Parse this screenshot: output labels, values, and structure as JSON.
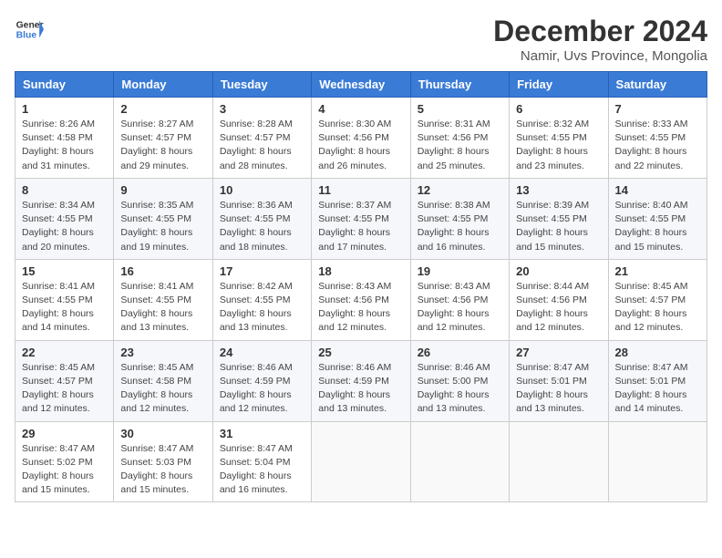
{
  "logo": {
    "general": "General",
    "blue": "Blue"
  },
  "title": "December 2024",
  "subtitle": "Namir, Uvs Province, Mongolia",
  "days_of_week": [
    "Sunday",
    "Monday",
    "Tuesday",
    "Wednesday",
    "Thursday",
    "Friday",
    "Saturday"
  ],
  "weeks": [
    [
      {
        "day": 1,
        "sunrise": "8:26 AM",
        "sunset": "4:58 PM",
        "daylight": "8 hours and 31 minutes."
      },
      {
        "day": 2,
        "sunrise": "8:27 AM",
        "sunset": "4:57 PM",
        "daylight": "8 hours and 29 minutes."
      },
      {
        "day": 3,
        "sunrise": "8:28 AM",
        "sunset": "4:57 PM",
        "daylight": "8 hours and 28 minutes."
      },
      {
        "day": 4,
        "sunrise": "8:30 AM",
        "sunset": "4:56 PM",
        "daylight": "8 hours and 26 minutes."
      },
      {
        "day": 5,
        "sunrise": "8:31 AM",
        "sunset": "4:56 PM",
        "daylight": "8 hours and 25 minutes."
      },
      {
        "day": 6,
        "sunrise": "8:32 AM",
        "sunset": "4:55 PM",
        "daylight": "8 hours and 23 minutes."
      },
      {
        "day": 7,
        "sunrise": "8:33 AM",
        "sunset": "4:55 PM",
        "daylight": "8 hours and 22 minutes."
      }
    ],
    [
      {
        "day": 8,
        "sunrise": "8:34 AM",
        "sunset": "4:55 PM",
        "daylight": "8 hours and 20 minutes."
      },
      {
        "day": 9,
        "sunrise": "8:35 AM",
        "sunset": "4:55 PM",
        "daylight": "8 hours and 19 minutes."
      },
      {
        "day": 10,
        "sunrise": "8:36 AM",
        "sunset": "4:55 PM",
        "daylight": "8 hours and 18 minutes."
      },
      {
        "day": 11,
        "sunrise": "8:37 AM",
        "sunset": "4:55 PM",
        "daylight": "8 hours and 17 minutes."
      },
      {
        "day": 12,
        "sunrise": "8:38 AM",
        "sunset": "4:55 PM",
        "daylight": "8 hours and 16 minutes."
      },
      {
        "day": 13,
        "sunrise": "8:39 AM",
        "sunset": "4:55 PM",
        "daylight": "8 hours and 15 minutes."
      },
      {
        "day": 14,
        "sunrise": "8:40 AM",
        "sunset": "4:55 PM",
        "daylight": "8 hours and 15 minutes."
      }
    ],
    [
      {
        "day": 15,
        "sunrise": "8:41 AM",
        "sunset": "4:55 PM",
        "daylight": "8 hours and 14 minutes."
      },
      {
        "day": 16,
        "sunrise": "8:41 AM",
        "sunset": "4:55 PM",
        "daylight": "8 hours and 13 minutes."
      },
      {
        "day": 17,
        "sunrise": "8:42 AM",
        "sunset": "4:55 PM",
        "daylight": "8 hours and 13 minutes."
      },
      {
        "day": 18,
        "sunrise": "8:43 AM",
        "sunset": "4:56 PM",
        "daylight": "8 hours and 12 minutes."
      },
      {
        "day": 19,
        "sunrise": "8:43 AM",
        "sunset": "4:56 PM",
        "daylight": "8 hours and 12 minutes."
      },
      {
        "day": 20,
        "sunrise": "8:44 AM",
        "sunset": "4:56 PM",
        "daylight": "8 hours and 12 minutes."
      },
      {
        "day": 21,
        "sunrise": "8:45 AM",
        "sunset": "4:57 PM",
        "daylight": "8 hours and 12 minutes."
      }
    ],
    [
      {
        "day": 22,
        "sunrise": "8:45 AM",
        "sunset": "4:57 PM",
        "daylight": "8 hours and 12 minutes."
      },
      {
        "day": 23,
        "sunrise": "8:45 AM",
        "sunset": "4:58 PM",
        "daylight": "8 hours and 12 minutes."
      },
      {
        "day": 24,
        "sunrise": "8:46 AM",
        "sunset": "4:59 PM",
        "daylight": "8 hours and 12 minutes."
      },
      {
        "day": 25,
        "sunrise": "8:46 AM",
        "sunset": "4:59 PM",
        "daylight": "8 hours and 13 minutes."
      },
      {
        "day": 26,
        "sunrise": "8:46 AM",
        "sunset": "5:00 PM",
        "daylight": "8 hours and 13 minutes."
      },
      {
        "day": 27,
        "sunrise": "8:47 AM",
        "sunset": "5:01 PM",
        "daylight": "8 hours and 13 minutes."
      },
      {
        "day": 28,
        "sunrise": "8:47 AM",
        "sunset": "5:01 PM",
        "daylight": "8 hours and 14 minutes."
      }
    ],
    [
      {
        "day": 29,
        "sunrise": "8:47 AM",
        "sunset": "5:02 PM",
        "daylight": "8 hours and 15 minutes."
      },
      {
        "day": 30,
        "sunrise": "8:47 AM",
        "sunset": "5:03 PM",
        "daylight": "8 hours and 15 minutes."
      },
      {
        "day": 31,
        "sunrise": "8:47 AM",
        "sunset": "5:04 PM",
        "daylight": "8 hours and 16 minutes."
      },
      null,
      null,
      null,
      null
    ]
  ]
}
